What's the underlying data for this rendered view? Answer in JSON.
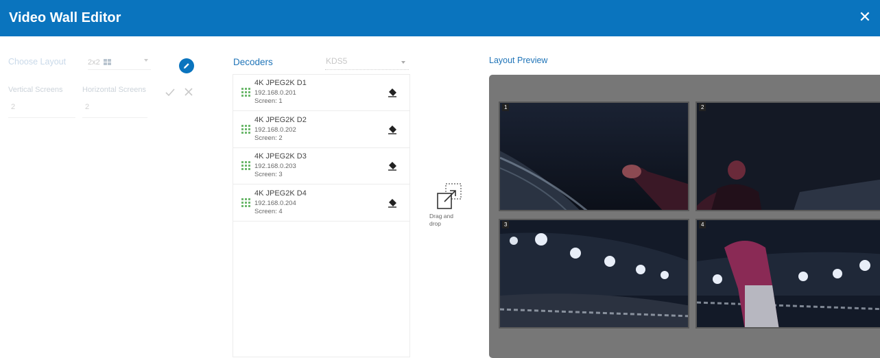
{
  "window": {
    "title": "Video Wall Editor"
  },
  "layout": {
    "choose_label": "Choose Layout",
    "selected": "2x2",
    "vertical_label": "Vertical Screens",
    "vertical_value": "2",
    "horizontal_label": "Horizontal Screens",
    "horizontal_value": "2"
  },
  "decoders": {
    "title": "Decoders",
    "group": "KDS5",
    "items": [
      {
        "name": "4K JPEG2K D1",
        "ip": "192.168.0.201",
        "screen": "Screen: 1"
      },
      {
        "name": "4K JPEG2K D2",
        "ip": "192.168.0.202",
        "screen": "Screen: 2"
      },
      {
        "name": "4K JPEG2K D3",
        "ip": "192.168.0.203",
        "screen": "Screen: 3"
      },
      {
        "name": "4K JPEG2K D4",
        "ip": "192.168.0.204",
        "screen": "Screen: 4"
      }
    ]
  },
  "drag_drop": {
    "line1": "Drag and",
    "line2": "drop"
  },
  "preview": {
    "title": "Layout Preview",
    "tiles": [
      "1",
      "2",
      "3",
      "4"
    ]
  },
  "colors": {
    "header": "#0a74be",
    "accent": "#1f74b8",
    "handle": "#6cb86c",
    "preview_bg": "#777777"
  },
  "icons": [
    "close-icon",
    "pencil-icon",
    "check-icon",
    "x-icon",
    "drag-handle-icon",
    "eraser-icon",
    "drag-drop-icon"
  ]
}
